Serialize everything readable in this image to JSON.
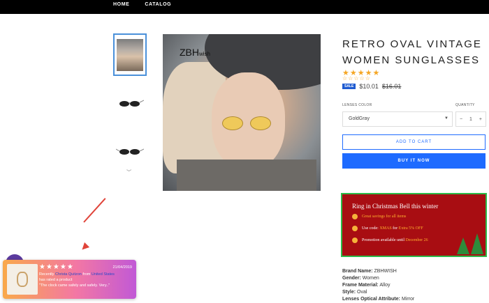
{
  "nav": {
    "items": [
      "HOME",
      "CATALOG"
    ]
  },
  "product": {
    "brand_watermark": "ZBH",
    "brand_watermark_small": "wish",
    "title": "RETRO OVAL VINTAGE WOMEN SUNGLASSES",
    "stars": "★★★★★",
    "rating_outline": "☆☆☆☆☆",
    "sale_badge": "SALE",
    "price": "$10.01",
    "old_price": "$16.01",
    "lenses_color_label": "LENSES COLOR",
    "lenses_color_value": "GoldGray",
    "quantity_label": "QUANTITY",
    "quantity_minus": "−",
    "quantity_value": "1",
    "quantity_plus": "+",
    "add_to_cart": "ADD TO CART",
    "buy_it_now": "BUY IT NOW",
    "chevron": "⌄"
  },
  "promo": {
    "title": "Ring in Christmas Bell this winter",
    "line1": "Great savings for all items",
    "line2_prefix": "Use code:",
    "line2_code": "XMAS",
    "line2_mid": "for",
    "line2_offer": "Extra 5% OFF",
    "line3_prefix": "Promotion available until",
    "line3_date": "December 26"
  },
  "specs": [
    {
      "label": "Brand Name:",
      "value": "ZBHWISH"
    },
    {
      "label": "Gender:",
      "value": "Women"
    },
    {
      "label": "Frame Material:",
      "value": "Alloy"
    },
    {
      "label": "Style:",
      "value": "Oval"
    },
    {
      "label": "Lenses Optical Attribute:",
      "value": "Mirror"
    }
  ],
  "toast": {
    "stars": "★★★★★",
    "date": "21/04/2019",
    "recently": "Recently",
    "name": "Christa Quitzon",
    "from": "from",
    "location": "United States",
    "rated": "has rated a product",
    "quote": "\"The clock came safely and safely. Very..\""
  },
  "colors": {
    "accent": "#1e6bff",
    "promo_bg": "#a80d12",
    "promo_border": "#2dbb4a",
    "annotation_arrow": "#e0443a"
  }
}
